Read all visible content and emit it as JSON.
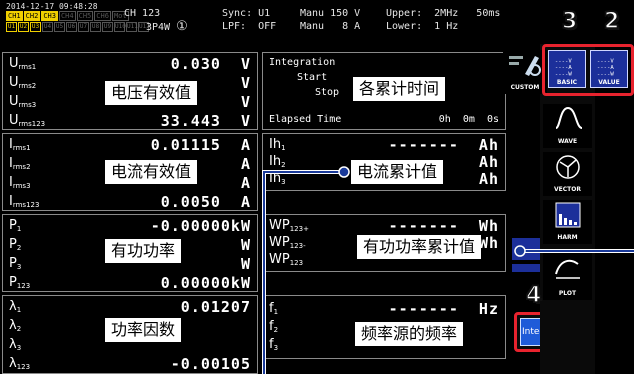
{
  "header": {
    "datetime": "2014-12-17 09:48:28",
    "channels": [
      "CH1",
      "CH2",
      "CH3",
      "CH4",
      "CH5",
      "CH6",
      "Mot"
    ],
    "channels_active": [
      true,
      true,
      true,
      false,
      false,
      false,
      false
    ],
    "units": [
      "U1",
      "U2",
      "U3",
      "U4",
      "U5",
      "U6",
      "U7",
      "U8",
      "U9",
      "U10",
      "U11",
      "U12"
    ],
    "channel_name": "CH 123",
    "wiring": "3P4W",
    "wiring_mark": "①",
    "sync": "Sync: U1",
    "lpf": "LPF:  OFF",
    "voltage_range": "Manu 150 V",
    "current_range": "Manu   8 A",
    "upper": "Upper:  2MHz   50ms",
    "lower": "Lower:  1 Hz"
  },
  "voltage_panel": {
    "rows": [
      {
        "label": "U",
        "sub": "rms1",
        "value": "0.030  V"
      },
      {
        "label": "U",
        "sub": "rms2",
        "value": "V"
      },
      {
        "label": "U",
        "sub": "rms3",
        "value": "V"
      },
      {
        "label": "U",
        "sub": "rms123",
        "value": "33.443  V"
      }
    ],
    "caption": "电压有效值"
  },
  "current_panel": {
    "rows": [
      {
        "label": "I",
        "sub": "rms1",
        "value": "0.01115  A"
      },
      {
        "label": "I",
        "sub": "rms2",
        "value": "A"
      },
      {
        "label": "I",
        "sub": "rms3",
        "value": "A"
      },
      {
        "label": "I",
        "sub": "rms123",
        "value": "0.0050  A"
      }
    ],
    "caption": "电流有效值"
  },
  "power_panel": {
    "rows": [
      {
        "label": "P",
        "sub": "1",
        "value": "-0.00000kW"
      },
      {
        "label": "P",
        "sub": "2",
        "value": "W"
      },
      {
        "label": "P",
        "sub": "3",
        "value": "W"
      },
      {
        "label": "P",
        "sub": "123",
        "value": "0.00000kW"
      }
    ],
    "caption": "有功功率"
  },
  "pf_panel": {
    "rows": [
      {
        "label": "λ",
        "sub": "1",
        "value": "0.01207"
      },
      {
        "label": "λ",
        "sub": "2",
        "value": ""
      },
      {
        "label": "λ",
        "sub": "3",
        "value": ""
      },
      {
        "label": "λ",
        "sub": "123",
        "value": "-0.00105"
      }
    ],
    "caption": "功率因数"
  },
  "integration_panel": {
    "title": "Integration",
    "start": "Start",
    "stop": "Stop",
    "elapsed": "Elapsed Time",
    "elapsed_value": "0h  0m  0s",
    "caption": "各累计时间"
  },
  "current_integ_panel": {
    "rows": [
      {
        "label": "Ih",
        "sub": "1",
        "value": "-------  Ah"
      },
      {
        "label": "Ih",
        "sub": "2",
        "value": "Ah"
      },
      {
        "label": "Ih",
        "sub": "3",
        "value": "Ah"
      }
    ],
    "caption": "电流累计值"
  },
  "power_integ_panel": {
    "rows": [
      {
        "label": "WP",
        "sub": "123+",
        "value": "-------  Wh"
      },
      {
        "label": "WP",
        "sub": "123-",
        "value": "Wh"
      },
      {
        "label": "WP",
        "sub": "123",
        "value": ""
      }
    ],
    "caption": "有功功率累计值"
  },
  "freq_panel": {
    "rows": [
      {
        "label": "f",
        "sub": "1",
        "value": "-------  Hz"
      },
      {
        "label": "f",
        "sub": "2",
        "value": ""
      },
      {
        "label": "f",
        "sub": "3",
        "value": ""
      }
    ],
    "caption": "频率源的频率"
  },
  "sidebar": {
    "customize_label": "CUSTOM",
    "basic_label": "BASIC",
    "value_label": "VALUE",
    "wave_label": "WAVE",
    "vector_label": "VECTOR",
    "harmonic_label": "HARM",
    "plot_label": "PLOT",
    "integ_button": "Integ."
  },
  "callouts": {
    "n2": "2",
    "n3": "3",
    "n4": "4"
  },
  "colors": {
    "accent_red": "#e8232e",
    "button_blue": "#1c2f9a",
    "channel_yellow": "#f0d000"
  }
}
